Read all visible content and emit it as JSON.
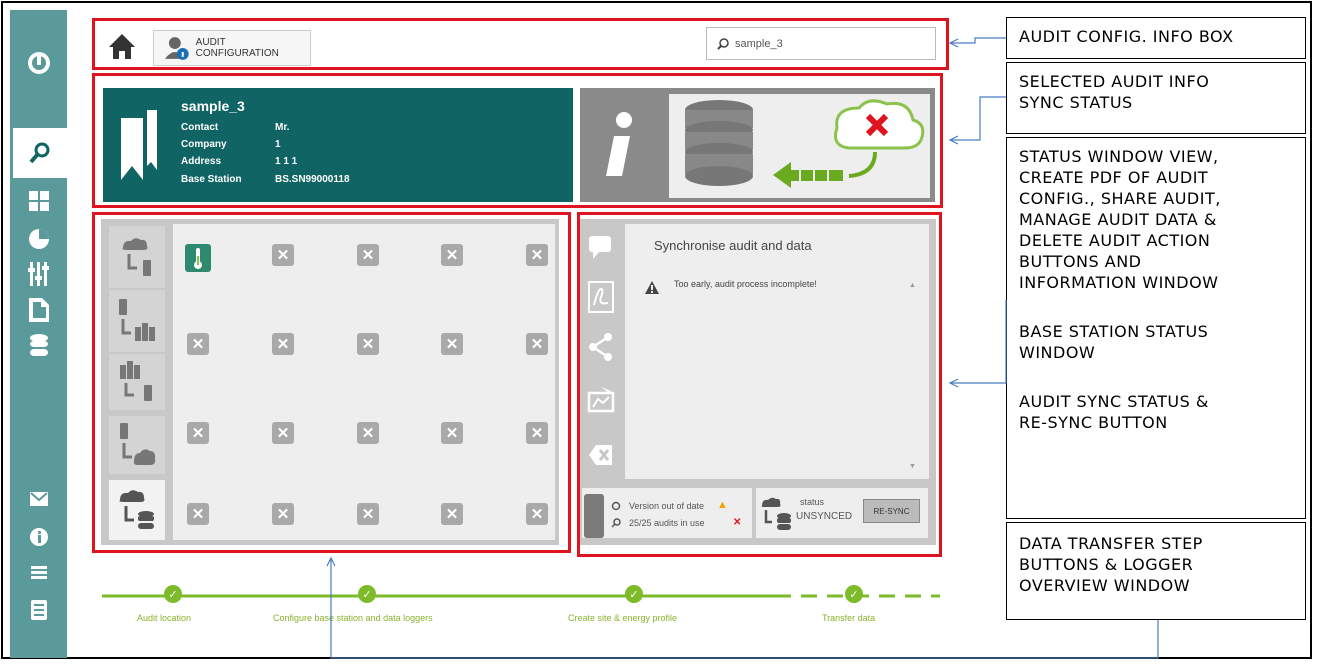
{
  "header": {
    "tab_label": "AUDIT CONFIGURATION",
    "search_value": "sample_3"
  },
  "audit": {
    "name": "sample_3",
    "fields": [
      {
        "label": "Contact",
        "value": "Mr."
      },
      {
        "label": "Company",
        "value": "1"
      },
      {
        "label": "Address",
        "value": "1 1 1"
      },
      {
        "label": "Base Station",
        "value": "BS.SN99000118"
      }
    ]
  },
  "info_window": {
    "title": "Synchronise audit and data",
    "message": "Too early, audit process incomplete!"
  },
  "status": {
    "version": "Version out of date",
    "audits_in_use": "25/25 audits in use",
    "status_label": "status",
    "status_value": "UNSYNCED",
    "resync_label": "RE-SYNC"
  },
  "progress": {
    "steps": [
      "Audit location",
      "Configure base station and data loggers",
      "Create site & energy profile",
      "Transfer data"
    ]
  },
  "annotations": {
    "audit_config_info_box": "AUDIT CONFIG. INFO BOX",
    "selected_audit_info": [
      "SELECTED AUDIT INFO",
      "SYNC STATUS"
    ],
    "status_window": [
      "STATUS WINDOW VIEW,",
      "CREATE PDF OF AUDIT",
      "CONFIG., SHARE AUDIT,",
      "MANAGE AUDIT DATA &",
      "DELETE AUDIT ACTION",
      "BUTTONS AND",
      "INFORMATION WINDOW"
    ],
    "base_station_status": [
      "BASE STATION STATUS",
      "WINDOW"
    ],
    "audit_sync_status": [
      "AUDIT SYNC STATUS &",
      "RE-SYNC BUTTON"
    ],
    "data_transfer": [
      "DATA TRANSFER STEP",
      "BUTTONS & LOGGER",
      "OVERVIEW WINDOW"
    ]
  },
  "colors": {
    "teal": "#116464",
    "sidebar": "#5a9a9a",
    "highlight_red": "#e0141e",
    "progress_green": "#7dbb2a"
  }
}
